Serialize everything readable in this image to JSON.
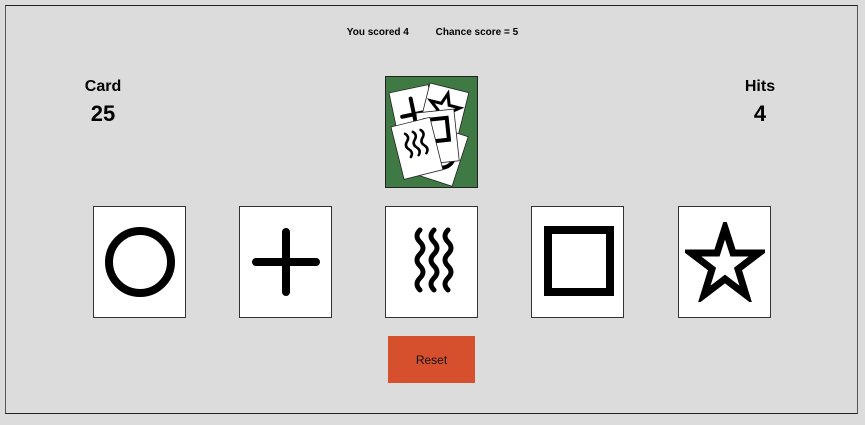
{
  "status": {
    "you_scored": "You scored 4",
    "chance_score": "Chance score = 5"
  },
  "card_counter": {
    "label": "Card",
    "value": "25"
  },
  "hits_counter": {
    "label": "Hits",
    "value": "4"
  },
  "deck": {
    "icon": "zener-card-deck-icon",
    "background": "#3f7a45"
  },
  "choices": [
    {
      "symbol": "circle"
    },
    {
      "symbol": "cross"
    },
    {
      "symbol": "waves"
    },
    {
      "symbol": "square"
    },
    {
      "symbol": "star"
    }
  ],
  "reset_button": {
    "label": "Reset",
    "color": "#d6502e"
  }
}
